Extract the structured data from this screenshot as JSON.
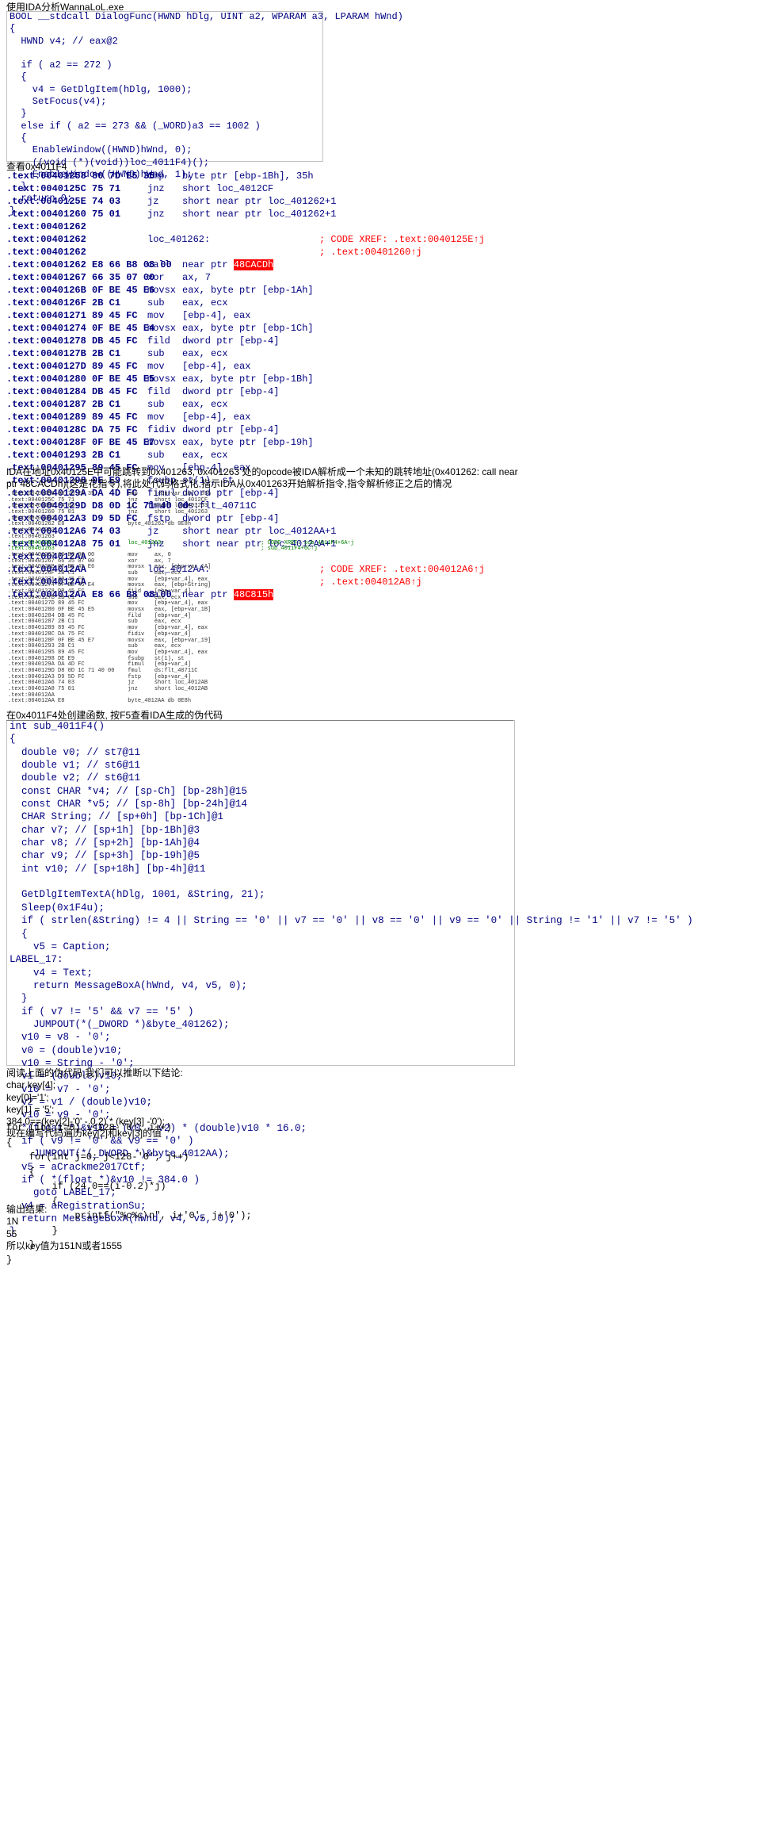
{
  "title": "使用IDA分析WannaLoL.exe",
  "dialog_func": {
    "lines": [
      "BOOL __stdcall DialogFunc(HWND hDlg, UINT a2, WPARAM a3, LPARAM hWnd)",
      "{",
      "  HWND v4; // eax@2",
      "",
      "  if ( a2 == 272 )",
      "  {",
      "    v4 = GetDlgItem(hDlg, 1000);",
      "    SetFocus(v4);",
      "  }",
      "  else if ( a2 == 273 && (_WORD)a3 == 1002 )",
      "  {",
      "    EnableWindow((HWND)hWnd, 0);",
      "    ((void (*)(void))loc_4011F4)();",
      "    EnableWindow((HWND)hWnd, 1);",
      "  }",
      "  return 0;",
      "}"
    ]
  },
  "look_label": "查看0x4011F4",
  "disasm": {
    "lines": [
      {
        "a": ".text:00401258 80 7D E5 35",
        "m": "cmp",
        "o": "byte ptr [ebp-1Bh], 35h",
        "x": ""
      },
      {
        "a": ".text:0040125C 75 71",
        "m": "jnz",
        "o": "short loc_4012CF",
        "x": ""
      },
      {
        "a": ".text:0040125E 74 03",
        "m": "jz",
        "o": "short near ptr loc_401262+1",
        "x": ""
      },
      {
        "a": ".text:00401260 75 01",
        "m": "jnz",
        "o": "short near ptr loc_401262+1",
        "x": ""
      },
      {
        "a": ".text:00401262",
        "m": "",
        "o": "",
        "x": ""
      },
      {
        "a": ".text:00401262",
        "m": "",
        "o": "loc_401262:",
        "x": "; CODE XREF: .text:0040125E↑j"
      },
      {
        "a": ".text:00401262",
        "m": "",
        "o": "",
        "x": "; .text:00401260↑j"
      },
      {
        "a": ".text:00401262 E8 66 B8 08 00",
        "m": "call",
        "o": "near ptr 48CACDh",
        "x": ""
      },
      {
        "a": ".text:00401267 66 35 07 00",
        "m": "xor",
        "o": "ax, 7",
        "x": ""
      },
      {
        "a": ".text:0040126B 0F BE 45 E6",
        "m": "movsx",
        "o": "eax, byte ptr [ebp-1Ah]",
        "x": ""
      },
      {
        "a": ".text:0040126F 2B C1",
        "m": "sub",
        "o": "eax, ecx",
        "x": ""
      },
      {
        "a": ".text:00401271 89 45 FC",
        "m": "mov",
        "o": "[ebp-4], eax",
        "x": ""
      },
      {
        "a": ".text:00401274 0F BE 45 E4",
        "m": "movsx",
        "o": "eax, byte ptr [ebp-1Ch]",
        "x": ""
      },
      {
        "a": ".text:00401278 DB 45 FC",
        "m": "fild",
        "o": "dword ptr [ebp-4]",
        "x": ""
      },
      {
        "a": ".text:0040127B 2B C1",
        "m": "sub",
        "o": "eax, ecx",
        "x": ""
      },
      {
        "a": ".text:0040127D 89 45 FC",
        "m": "mov",
        "o": "[ebp-4], eax",
        "x": ""
      },
      {
        "a": ".text:00401280 0F BE 45 E5",
        "m": "movsx",
        "o": "eax, byte ptr [ebp-1Bh]",
        "x": ""
      },
      {
        "a": ".text:00401284 DB 45 FC",
        "m": "fild",
        "o": "dword ptr [ebp-4]",
        "x": ""
      },
      {
        "a": ".text:00401287 2B C1",
        "m": "sub",
        "o": "eax, ecx",
        "x": ""
      },
      {
        "a": ".text:00401289 89 45 FC",
        "m": "mov",
        "o": "[ebp-4], eax",
        "x": ""
      },
      {
        "a": ".text:0040128C DA 75 FC",
        "m": "fidiv",
        "o": "dword ptr [ebp-4]",
        "x": ""
      },
      {
        "a": ".text:0040128F 0F BE 45 E7",
        "m": "movsx",
        "o": "eax, byte ptr [ebp-19h]",
        "x": ""
      },
      {
        "a": ".text:00401293 2B C1",
        "m": "sub",
        "o": "eax, ecx",
        "x": ""
      },
      {
        "a": ".text:00401295 89 45 FC",
        "m": "mov",
        "o": "[ebp-4], eax",
        "x": ""
      },
      {
        "a": ".text:00401298 DE E9",
        "m": "fsubp",
        "o": "st(1), st",
        "x": ""
      },
      {
        "a": ".text:0040129A DA 4D FC",
        "m": "fimul",
        "o": "dword ptr [ebp-4]",
        "x": ""
      },
      {
        "a": ".text:0040129D D8 0D 1C 71 40 00",
        "m": "fmul",
        "o": "ds:flt_40711C",
        "x": ""
      },
      {
        "a": ".text:004012A3 D9 5D FC",
        "m": "fstp",
        "o": "dword ptr [ebp-4]",
        "x": ""
      },
      {
        "a": ".text:004012A6 74 03",
        "m": "jz",
        "o": "short near ptr loc_4012AA+1",
        "x": ""
      },
      {
        "a": ".text:004012A8 75 01",
        "m": "jnz",
        "o": "short near ptr loc_4012AA+1",
        "x": ""
      },
      {
        "a": ".text:004012AA",
        "m": "",
        "o": "",
        "x": ""
      },
      {
        "a": ".text:004012AA",
        "m": "",
        "o": "loc_4012AA:",
        "x": "; CODE XREF: .text:004012A6↑j"
      },
      {
        "a": ".text:004012AA",
        "m": "",
        "o": "",
        "x": "; .text:004012A8↑j"
      },
      {
        "a": ".text:004012AA E8 66 B8 08 00",
        "m": "call",
        "o": "near ptr 48C815h",
        "x": ""
      }
    ]
  },
  "explain_1": "IDA在地址0x40125E中可能跳转到0x401263, 0x401263 处的opcode被IDA解析成一个未知的跳转地址(0x401262: call near ptr 48CACDh)(这是花指令),将此处代码格式化,指示IDA从0x401263开始解析指令,指令解析修正之后的情况",
  "mini_disasm": {
    "lines": [
      ".text:00401258 80 7D E5 35          cmp     [ebp+var_1B], 35h",
      ".text:0040125C 75 71                jnz     short loc_4012CF",
      ".text:0040125E 74 03                jz      short loc_401263",
      ".text:00401260 75 01                jnz     short loc_401263",
      ".text:00401262",
      ".text:00401262 E8                   byte_401262 db 0E8h",
      ".text:00401263",
      ".text:00401263",
      ".text:00401263                      loc_401263:                             ; CODE XREF: sub_4011F4+6A↑j",
      ".text:00401263                                                              ; sub_4011F4+6C↑j",
      ".text:00401263 66 B8 00 00          mov     ax, 0",
      ".text:00401267 66 35 07 00          xor     ax, 7",
      ".text:0040126B 0F BE 45 E6          movsx   eax, [ebp+var_1A]",
      ".text:0040126F 2B C1                sub     eax, ecx",
      ".text:00401271 89 45 FC             mov     [ebp+var_4], eax",
      ".text:00401274 0F BE 45 E4          movsx   eax, [ebp+String]",
      ".text:00401278 DB 45 FC             fild    [ebp+var_4]",
      ".text:0040127B 2B C1                sub     eax, ecx",
      ".text:0040127D 89 45 FC             mov     [ebp+var_4], eax",
      ".text:00401280 0F BE 45 E5          movsx   eax, [ebp+var_1B]",
      ".text:00401284 DB 45 FC             fild    [ebp+var_4]",
      ".text:00401287 2B C1                sub     eax, ecx",
      ".text:00401289 89 45 FC             mov     [ebp+var_4], eax",
      ".text:0040128C DA 75 FC             fidiv   [ebp+var_4]",
      ".text:0040128F 0F BE 45 E7          movsx   eax, [ebp+var_19]",
      ".text:00401293 2B C1                sub     eax, ecx",
      ".text:00401295 89 45 FC             mov     [ebp+var_4], eax",
      ".text:00401298 DE E9                fsubp   st(1), st",
      ".text:0040129A DA 4D FC             fimul   [ebp+var_4]",
      ".text:0040129D D8 0D 1C 71 40 00    fmul    ds:flt_40711C",
      ".text:004012A3 D9 5D FC             fstp    [ebp+var_4]",
      ".text:004012A6 74 03                jz      short loc_4012AB",
      ".text:004012A8 75 01                jnz     short loc_4012AB",
      ".text:004012AA",
      ".text:004012AA E8                   byte_4012AA db 0E8h"
    ]
  },
  "explain_2": "在0x4011F4处创建函数, 按F5查看IDA生成的伪代码",
  "pseudo": {
    "lines": [
      "int sub_4011F4()",
      "{",
      "  double v0; // st7@11",
      "  double v1; // st6@11",
      "  double v2; // st6@11",
      "  const CHAR *v4; // [sp-Ch] [bp-28h]@15",
      "  const CHAR *v5; // [sp-8h] [bp-24h]@14",
      "  CHAR String; // [sp+0h] [bp-1Ch]@1",
      "  char v7; // [sp+1h] [bp-1Bh]@3",
      "  char v8; // [sp+2h] [bp-1Ah]@4",
      "  char v9; // [sp+3h] [bp-19h]@5",
      "  int v10; // [sp+18h] [bp-4h]@11",
      "",
      "  GetDlgItemTextA(hDlg, 1001, &String, 21);",
      "  Sleep(0x1F4u);",
      "  if ( strlen(&String) != 4 || String == '0' || v7 == '0' || v8 == '0' || v9 == '0' || String != '1' || v7 != '5' )",
      "  {",
      "    v5 = Caption;",
      "LABEL_17:",
      "    v4 = Text;",
      "    return MessageBoxA(hWnd, v4, v5, 0);",
      "  }",
      "  if ( v7 != '5' && v7 == '5' )",
      "    JUMPOUT(*(_DWORD *)&byte_401262);",
      "  v10 = v8 - '0';",
      "  v0 = (double)v10;",
      "  v10 = String - '0';",
      "  v1 = (double)v10;",
      "  v10 = v7 - '0';",
      "  v2 = v1 / (double)v10;",
      "  v10 = v9 - '0';",
      "  *(float *)&v10 = (v0 - v2) * (double)v10 * 16.0;",
      "  if ( v9 != '0' && v9 == '0' )",
      "    JUMPOUT(*(_DWORD *)&byte_4012AA);",
      "  v5 = aCrackme2017Ctf;",
      "  if ( *(float *)&v10 != 384.0 )",
      "    goto LABEL_17;",
      "  v4 = aRegistrationSu;",
      "  return MessageBoxA(hWnd, v4, v5, 0);",
      "}"
    ]
  },
  "conclusion": {
    "lines": [
      "阅读上面的伪代码,我们可以推断以下结论:",
      "char key[4];",
      "key[0]='1';",
      "key[1] = '5';",
      "384.0==(key[2]-'0' - 0.2) * (key[3] -'0');",
      "现在编写代码遍历key[2]和key[3]的值"
    ]
  },
  "brute": {
    "lines": [
      "for (int i=0; i<128-'0'; i++)",
      "{",
      "    for(int j=0; j<128-'0'; j++)",
      "    {",
      "        if (24.0==(i-0.2)*j)",
      "        {",
      "            printf(\"%c%c\\n\", i+'0', j+'0');",
      "        }",
      "    }",
      "}"
    ]
  },
  "result": {
    "lines": [
      "输出结果:",
      "1N",
      "55",
      "所以key值为151N或者1555"
    ]
  },
  "colors": {
    "code_text": "#000080",
    "function": "#e000e0",
    "comment": "#0000ff",
    "highlight": "#ffff00",
    "xref": "#ff0000"
  }
}
